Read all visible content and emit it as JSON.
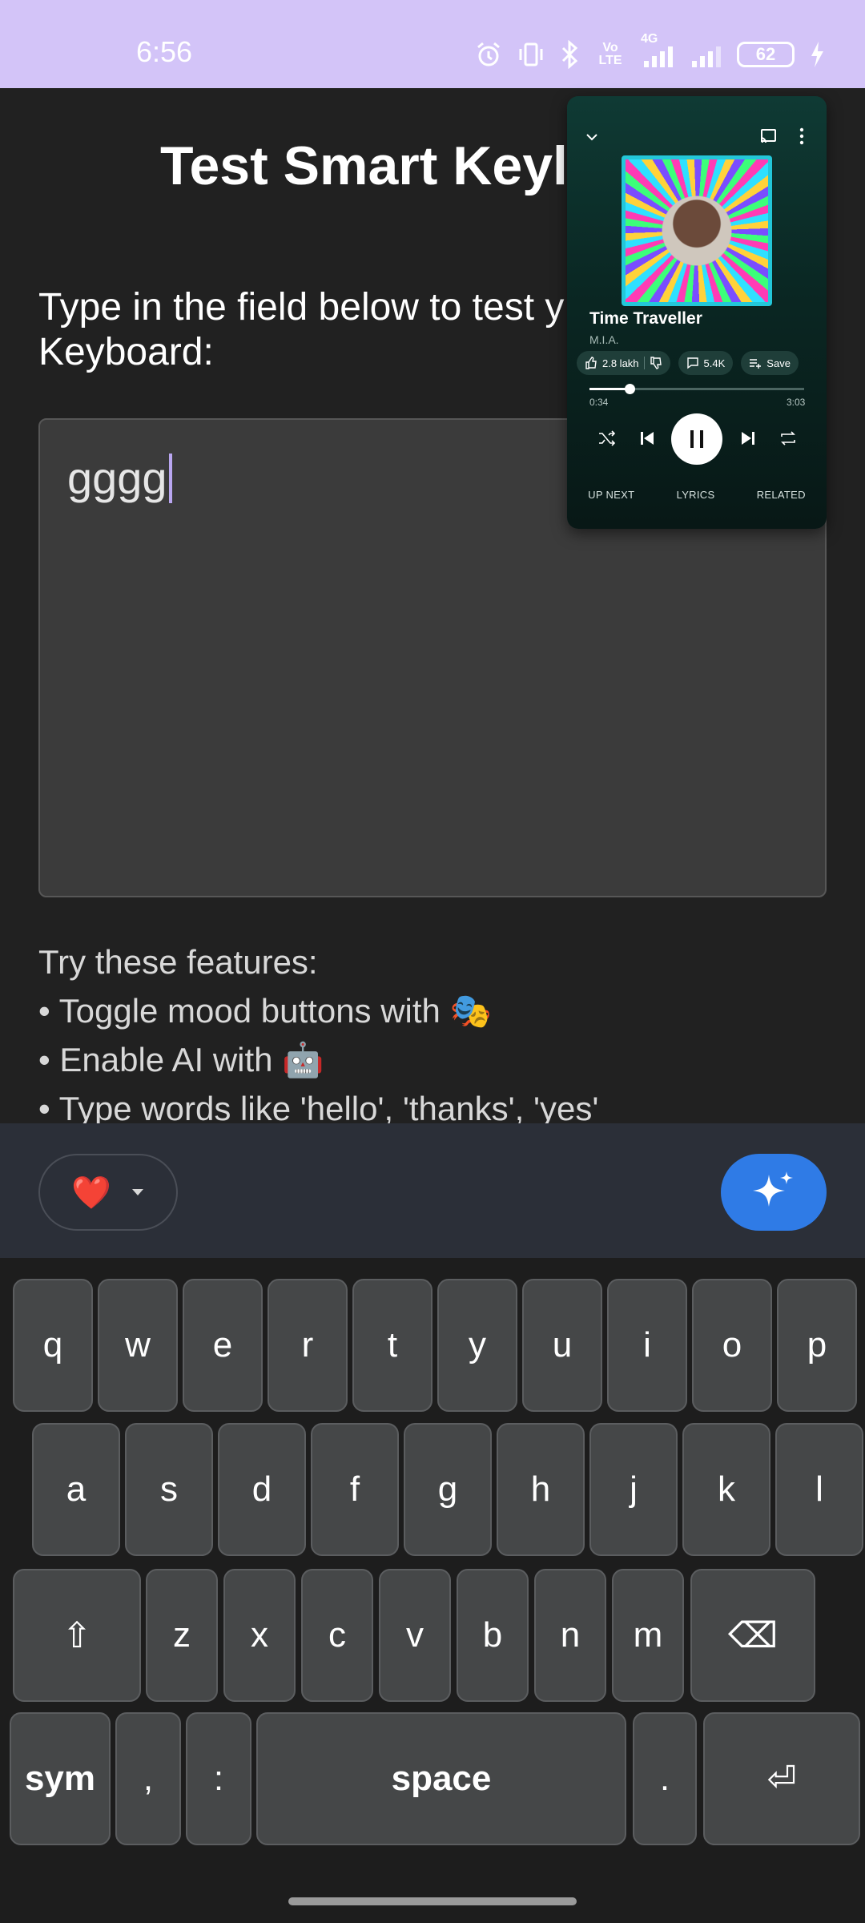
{
  "status_bar": {
    "time": "6:56",
    "battery": "62",
    "network": "4G",
    "volte": "Vo LTE"
  },
  "app": {
    "title": "Test Smart Keyl",
    "instructions": "Type in the field below to test y… Keyboard:",
    "instructions_line1": "Type in the field below to test y",
    "instructions_line2": "Keyboard:",
    "field_value": "gggg",
    "features": [
      "Try these features:",
      "• Toggle mood buttons with 🎭",
      "• Enable AI with 🤖",
      "• Type words like 'hello', 'thanks', 'yes'"
    ]
  },
  "mini_player": {
    "song_title": "Time Traveller",
    "artist": "M.I.A.",
    "likes": "2.8 lakh",
    "comments": "5.4K",
    "save_label": "Save",
    "current_time": "0:34",
    "total_time": "3:03",
    "progress": 0.186,
    "tabs": [
      "UP NEXT",
      "LYRICS",
      "RELATED"
    ]
  },
  "keyboard": {
    "mood_emoji": "❤️",
    "row1": [
      "q",
      "w",
      "e",
      "r",
      "t",
      "y",
      "u",
      "i",
      "o",
      "p"
    ],
    "row2": [
      "a",
      "s",
      "d",
      "f",
      "g",
      "h",
      "j",
      "k",
      "l"
    ],
    "row3": [
      "z",
      "x",
      "c",
      "v",
      "b",
      "n",
      "m"
    ],
    "shift": "⇧",
    "backspace": "⌫",
    "sym": "sym",
    "comma": ",",
    "colon": ":",
    "space": "space",
    "period": ".",
    "enter": "⏎",
    "colors": {
      "toolbar": "#2b2f38",
      "key": "#454748",
      "ai_button": "#2f7be6"
    }
  }
}
